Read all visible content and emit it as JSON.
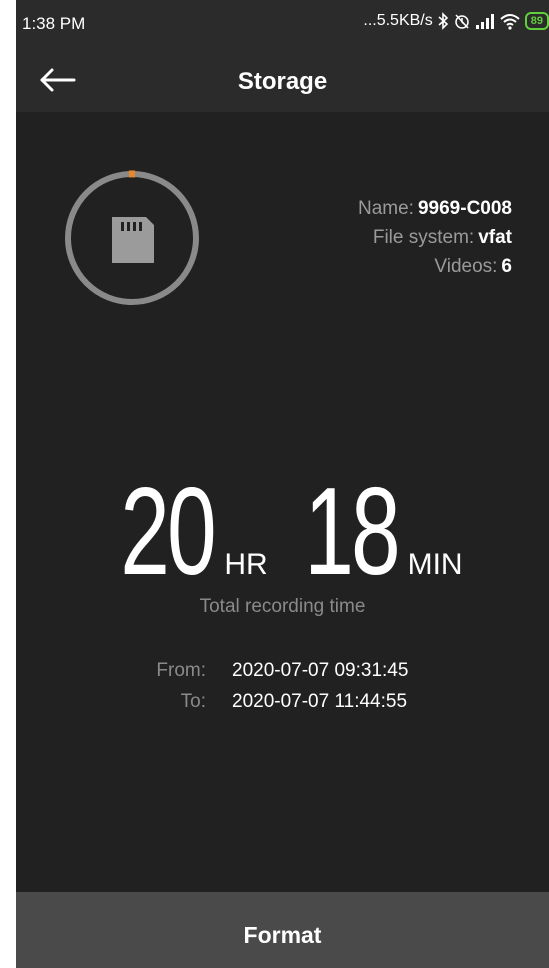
{
  "status_bar": {
    "time": "1:38 PM",
    "network_speed": "...5.5KB/s",
    "battery": "89",
    "icons": [
      "bluetooth-icon",
      "alarm-off-icon",
      "signal-icon",
      "wifi-icon",
      "battery-icon"
    ]
  },
  "app_bar": {
    "title": "Storage",
    "back_icon": "arrow-left-icon"
  },
  "storage": {
    "icon": "sd-card-icon",
    "name_label": "Name:",
    "name_value": "9969-C008",
    "fs_label": "File system:",
    "fs_value": "vfat",
    "videos_label": "Videos:",
    "videos_value": "6",
    "ring_usage_fraction": 0.01,
    "colors": {
      "ring": "#8a8a8a",
      "ring_indicator": "#e7872b",
      "card": "#9b9b9b"
    }
  },
  "recording": {
    "hours": "20",
    "hours_unit": "HR",
    "minutes": "18",
    "minutes_unit": "MIN",
    "total_label": "Total recording time",
    "from_label": "From:",
    "from_value": "2020-07-07 09:31:45",
    "to_label": "To:",
    "to_value": "2020-07-07 11:44:55"
  },
  "actions": {
    "format_label": "Format"
  },
  "colors": {
    "background": "#212121",
    "bar": "#2b2b2b",
    "format_button": "#4a4a4a",
    "battery": "#5fcf3a"
  }
}
